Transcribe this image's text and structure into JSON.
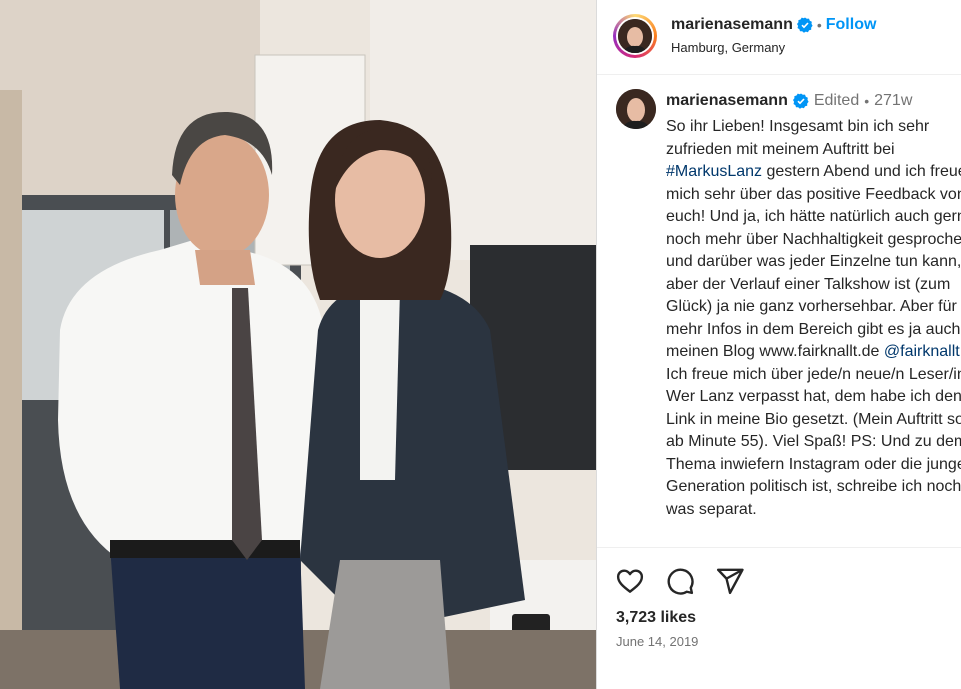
{
  "post": {
    "username": "marienasemann",
    "follow_label": "Follow",
    "separator": "•",
    "location": "Hamburg, Germany"
  },
  "caption": {
    "username": "marienasemann",
    "edited": "Edited",
    "separator": "•",
    "time": "271w",
    "text_part1": "So ihr Lieben! Insgesamt bin ich sehr zufrieden mit meinem Auftritt bei ",
    "hashtag": "#MarkusLanz",
    "text_part2": " gestern Abend und ich freue mich sehr über das positive Feedback von euch! Und ja, ich hätte natürlich auch gerne noch mehr über Nachhaltigkeit gesprochen und darüber was jeder Einzelne tun kann, aber der Verlauf einer Talkshow ist (zum Glück) ja nie ganz vorhersehbar. Aber für mehr Infos in dem Bereich gibt es ja auch meinen Blog www.fairknallt.de ",
    "mention": "@fairknallt",
    "text_part3": " ! Ich freue mich über jede/n neue/n Leser/in!\nWer Lanz verpasst hat, dem habe ich den Link in meine Bio gesetzt. (Mein Auftritt so ab Minute 55). Viel Spaß! PS: Und zu dem Thema inwiefern Instagram oder die junge Generation politisch ist, schreibe ich noch was separat."
  },
  "engagement": {
    "likes": "3,723 likes",
    "date": "June 14, 2019"
  },
  "icons": {
    "like": "heart-icon",
    "comment": "comment-icon",
    "share": "share-icon",
    "verified": "verified-badge-icon"
  },
  "colors": {
    "accent": "#0095f6",
    "link": "#00376b",
    "muted": "#737373"
  }
}
